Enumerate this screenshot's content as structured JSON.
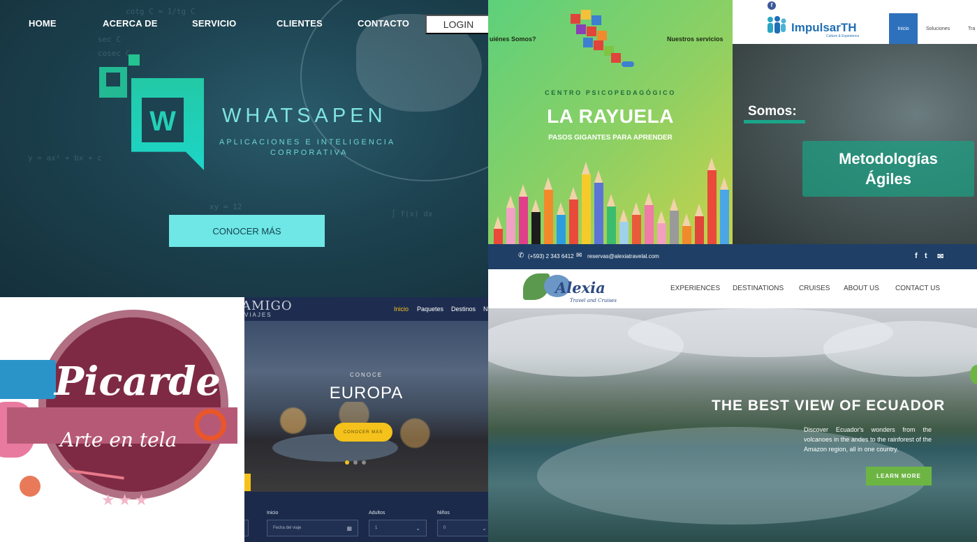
{
  "whatsapen": {
    "nav": [
      "HOME",
      "ACERCA DE",
      "SERVICIO",
      "CLIENTES",
      "CONTACTO"
    ],
    "login_label": "LOGIN",
    "brand": "WHATSAPEN",
    "logo_letter": "W",
    "tagline_line1": "APLICACIONES E INTELIGENCIA",
    "tagline_line2": "CORPORATIVA",
    "cta_label": "CONOCER MÁS",
    "accent_color": "#6ee7e6"
  },
  "rayuela": {
    "nav_left": "uiénes Somos?",
    "nav_right": "Nuestros servicios",
    "pretitle": "CENTRO PSICOPEDAGÓGICO",
    "title": "LA RAYUELA",
    "tagline": "PASOS GIGANTES PARA APRENDER"
  },
  "impulsar": {
    "brand": "ImpulsarTH",
    "brand_tagline": "Culture & Experience",
    "nav_active": "Inicio",
    "nav": [
      "Soluciones",
      "Tra"
    ],
    "somos_label": "Somos:",
    "box_line1": "Metodologías",
    "box_line2": "Ágiles",
    "social_icon": "facebook-icon"
  },
  "picarde": {
    "title": "Picarde",
    "subtitle": "Arte en tela",
    "stars": "★★★"
  },
  "amigo": {
    "logo": "AMIGO",
    "logo_sub": "VIAJES",
    "nav_active": "Inicio",
    "nav": [
      "Paquetes",
      "Destinos",
      "No"
    ],
    "pretitle": "CONOCE",
    "title": "EUROPA",
    "cta_label": "CONOCER MÁS",
    "form": {
      "label_inicio": "Inicio",
      "label_adultos": "Adultos",
      "label_ninos": "Niños",
      "date_placeholder": "Fecha del viaje",
      "adults_value": "1",
      "kids_value": "0"
    }
  },
  "alexia": {
    "phone": "(+593) 2 343 6412",
    "email": "reservas@alexiatravelal.com",
    "brand": "Alexia",
    "brand_sub": "Travel and Cruises",
    "nav": [
      "EXPERIENCES",
      "DESTINATIONS",
      "CRUISES",
      "ABOUT US",
      "CONTACT US"
    ],
    "headline": "THE BEST VIEW OF ECUADOR",
    "description": "Discover Ecuador's wonders from the volcanoes in the andes to the rainforest of the Amazon region, all in one country.",
    "cta_label": "LEARN MORE",
    "social": [
      "f",
      "t",
      "✉"
    ],
    "accent_color": "#6db543"
  }
}
